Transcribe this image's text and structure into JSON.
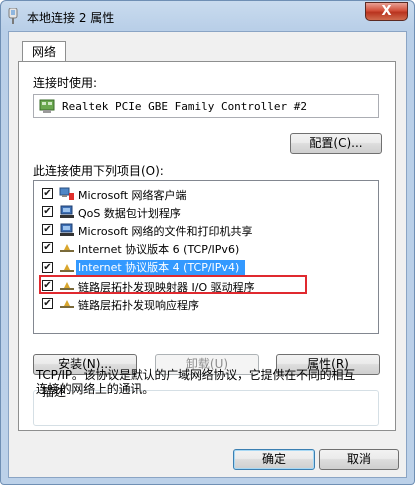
{
  "window": {
    "title": "本地连接 2 属性",
    "close_symbol": "X"
  },
  "tab": {
    "label": "网络"
  },
  "connect_using": {
    "label": "连接时使用:",
    "adapter": "Realtek PCIe GBE Family Controller #2"
  },
  "configure_button": "配置(C)...",
  "items_label": "此连接使用下列项目(O):",
  "items": [
    {
      "label": "Microsoft 网络客户端",
      "checked": true,
      "icon": "network-client-icon"
    },
    {
      "label": "QoS 数据包计划程序",
      "checked": true,
      "icon": "qos-scheduler-icon"
    },
    {
      "label": "Microsoft 网络的文件和打印机共享",
      "checked": true,
      "icon": "file-printer-sharing-icon"
    },
    {
      "label": "Internet 协议版本 6 (TCP/IPv6)",
      "checked": true,
      "icon": "protocol-icon"
    },
    {
      "label": "Internet 协议版本 4 (TCP/IPv4)",
      "checked": true,
      "icon": "protocol-icon",
      "selected": true
    },
    {
      "label": "链路层拓扑发现映射器 I/O 驱动程序",
      "checked": true,
      "icon": "protocol-icon"
    },
    {
      "label": "链路层拓扑发现响应程序",
      "checked": true,
      "icon": "protocol-icon"
    }
  ],
  "buttons": {
    "install": "安装(N)...",
    "uninstall": "卸载(U)",
    "properties": "属性(R)",
    "ok": "确定",
    "cancel": "取消"
  },
  "description": {
    "title": "描述",
    "text": "TCP/IP。该协议是默认的广域网络协议，它提供在不同的相互连接的网络上的通讯。"
  },
  "colors": {
    "selection": "#3399ff",
    "highlight_border": "#e0292f"
  }
}
